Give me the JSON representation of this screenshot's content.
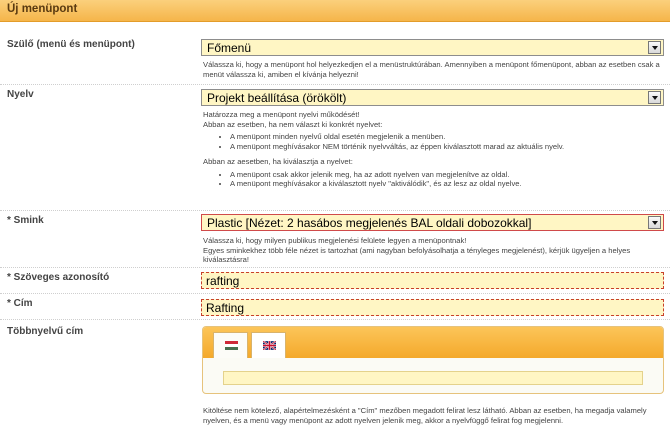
{
  "panel": {
    "title": "Új menüpont"
  },
  "parent": {
    "label": "Szülő (menü és menüpont)",
    "value": "Főmenü",
    "help": "Válassza ki, hogy a menüpont hol helyezkedjen el a menüstruktúrában. Amennyiben a menüpont főmenüpont, abban az esetben csak a menüt válassza ki, amiben el kívánja helyezni!"
  },
  "language": {
    "label": "Nyelv",
    "value": "Projekt beállítása (örökölt)",
    "help_intro_1": "Határozza meg a menüpont nyelvi működését!",
    "help_intro_2": "Abban az esetben, ha nem választ ki konkrét nyelvet:",
    "help_list_1": [
      "A menüpont minden nyelvű oldal esetén megjelenik a menüben.",
      "A menüpont meghívásakor NEM történik nyelvváltás, az éppen kiválasztott marad az aktuális nyelv."
    ],
    "help_intro_3": "Abban az aesetben, ha kiválasztja a nyelvet:",
    "help_list_2": [
      "A menüpont csak akkor jelenik meg, ha az adott nyelven van megjelenítve az oldal.",
      "A menüpont meghívásakor a kiválasztott nyelv \"aktiválódik\", és az lesz az oldal nyelve."
    ]
  },
  "skin": {
    "label": "* Smink",
    "value": "Plastic [Nézet: 2 hasábos megjelenés BAL oldali dobozokkal]",
    "help_1": "Válassza ki, hogy milyen publikus megjelenési felülete legyen a menüpontnak!",
    "help_2": "Egyes sminkekhez több féle nézet is tartozhat (ami nagyban befolyásolhatja a tényleges megjelenést), kérjük ügyeljen a helyes kiválasztásra!"
  },
  "text_id": {
    "label": "* Szöveges azonosító",
    "value": "rafting"
  },
  "title_field": {
    "label": "* Cím",
    "value": "Rafting"
  },
  "multilang": {
    "label": "Többnyelvű cím",
    "tabs": [
      {
        "icon": "hungarian-flag-icon",
        "active": true
      },
      {
        "icon": "uk-flag-icon",
        "active": false
      }
    ],
    "value": "",
    "help": "Kitöltése nem kötelező, alapértelmezésként a \"Cím\" mezőben megadott felirat lesz látható. Abban az esetben, ha megadja valamely nyelven, és a menü vagy menüpont az adott nyelven jelenik meg, akkor a nyelvfüggő felirat fog megjelenni."
  },
  "colors": {
    "header": "#f5b54a",
    "field_bg": "#fff6c4",
    "required_border": "#c8402a"
  }
}
